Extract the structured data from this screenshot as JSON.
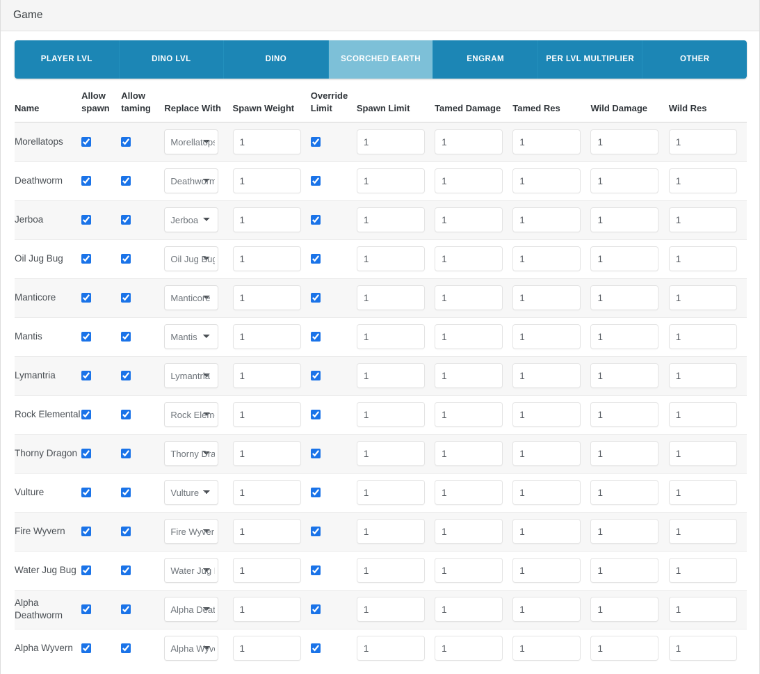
{
  "window": {
    "title": "Game"
  },
  "tabs": [
    {
      "label": "PLAYER LVL",
      "active": false
    },
    {
      "label": "DINO LVL",
      "active": false
    },
    {
      "label": "DINO",
      "active": false
    },
    {
      "label": "SCORCHED EARTH",
      "active": true
    },
    {
      "label": "ENGRAM",
      "active": false
    },
    {
      "label": "PER LVL MULTIPLIER",
      "active": false
    },
    {
      "label": "OTHER",
      "active": false
    }
  ],
  "table": {
    "columns": [
      "Name",
      "Allow spawn",
      "Allow taming",
      "Replace With",
      "Spawn Weight",
      "Override Limit",
      "Spawn Limit",
      "Tamed Damage",
      "Tamed Res",
      "Wild Damage",
      "Wild Res"
    ],
    "rows": [
      {
        "name": "Morellatops",
        "allow_spawn": true,
        "allow_taming": true,
        "replace_with": "Morellatops",
        "spawn_weight": "1",
        "override_limit": true,
        "spawn_limit": "1",
        "tamed_damage": "1",
        "tamed_res": "1",
        "wild_damage": "1",
        "wild_res": "1"
      },
      {
        "name": "Deathworm",
        "allow_spawn": true,
        "allow_taming": true,
        "replace_with": "Deathworm",
        "spawn_weight": "1",
        "override_limit": true,
        "spawn_limit": "1",
        "tamed_damage": "1",
        "tamed_res": "1",
        "wild_damage": "1",
        "wild_res": "1"
      },
      {
        "name": "Jerboa",
        "allow_spawn": true,
        "allow_taming": true,
        "replace_with": "Jerboa",
        "spawn_weight": "1",
        "override_limit": true,
        "spawn_limit": "1",
        "tamed_damage": "1",
        "tamed_res": "1",
        "wild_damage": "1",
        "wild_res": "1"
      },
      {
        "name": "Oil Jug Bug",
        "allow_spawn": true,
        "allow_taming": true,
        "replace_with": "Oil Jug Bug",
        "spawn_weight": "1",
        "override_limit": true,
        "spawn_limit": "1",
        "tamed_damage": "1",
        "tamed_res": "1",
        "wild_damage": "1",
        "wild_res": "1"
      },
      {
        "name": "Manticore",
        "allow_spawn": true,
        "allow_taming": true,
        "replace_with": "Manticore",
        "spawn_weight": "1",
        "override_limit": true,
        "spawn_limit": "1",
        "tamed_damage": "1",
        "tamed_res": "1",
        "wild_damage": "1",
        "wild_res": "1"
      },
      {
        "name": "Mantis",
        "allow_spawn": true,
        "allow_taming": true,
        "replace_with": "Mantis",
        "spawn_weight": "1",
        "override_limit": true,
        "spawn_limit": "1",
        "tamed_damage": "1",
        "tamed_res": "1",
        "wild_damage": "1",
        "wild_res": "1"
      },
      {
        "name": "Lymantria",
        "allow_spawn": true,
        "allow_taming": true,
        "replace_with": "Lymantria",
        "spawn_weight": "1",
        "override_limit": true,
        "spawn_limit": "1",
        "tamed_damage": "1",
        "tamed_res": "1",
        "wild_damage": "1",
        "wild_res": "1"
      },
      {
        "name": "Rock Elemental",
        "allow_spawn": true,
        "allow_taming": true,
        "replace_with": "Rock Elemental",
        "spawn_weight": "1",
        "override_limit": true,
        "spawn_limit": "1",
        "tamed_damage": "1",
        "tamed_res": "1",
        "wild_damage": "1",
        "wild_res": "1"
      },
      {
        "name": "Thorny Dragon",
        "allow_spawn": true,
        "allow_taming": true,
        "replace_with": "Thorny Dragon",
        "spawn_weight": "1",
        "override_limit": true,
        "spawn_limit": "1",
        "tamed_damage": "1",
        "tamed_res": "1",
        "wild_damage": "1",
        "wild_res": "1"
      },
      {
        "name": "Vulture",
        "allow_spawn": true,
        "allow_taming": true,
        "replace_with": "Vulture",
        "spawn_weight": "1",
        "override_limit": true,
        "spawn_limit": "1",
        "tamed_damage": "1",
        "tamed_res": "1",
        "wild_damage": "1",
        "wild_res": "1"
      },
      {
        "name": "Fire Wyvern",
        "allow_spawn": true,
        "allow_taming": true,
        "replace_with": "Fire Wyvern",
        "spawn_weight": "1",
        "override_limit": true,
        "spawn_limit": "1",
        "tamed_damage": "1",
        "tamed_res": "1",
        "wild_damage": "1",
        "wild_res": "1"
      },
      {
        "name": "Water Jug Bug",
        "allow_spawn": true,
        "allow_taming": true,
        "replace_with": "Water Jug Bug",
        "spawn_weight": "1",
        "override_limit": true,
        "spawn_limit": "1",
        "tamed_damage": "1",
        "tamed_res": "1",
        "wild_damage": "1",
        "wild_res": "1"
      },
      {
        "name": "Alpha Deathworm",
        "allow_spawn": true,
        "allow_taming": true,
        "replace_with": "Alpha Deathworm",
        "spawn_weight": "1",
        "override_limit": true,
        "spawn_limit": "1",
        "tamed_damage": "1",
        "tamed_res": "1",
        "wild_damage": "1",
        "wild_res": "1"
      },
      {
        "name": "Alpha Wyvern",
        "allow_spawn": true,
        "allow_taming": true,
        "replace_with": "Alpha Wyvern",
        "spawn_weight": "1",
        "override_limit": true,
        "spawn_limit": "1",
        "tamed_damage": "1",
        "tamed_res": "1",
        "wild_damage": "1",
        "wild_res": "1"
      }
    ]
  },
  "colors": {
    "tab_inactive": "#1c86b5",
    "tab_active": "#7dc0d8",
    "checkbox_accent": "#1a73e8",
    "titlebar_bg": "#f5f5f5",
    "row_stripe": "#f7f7f7"
  }
}
